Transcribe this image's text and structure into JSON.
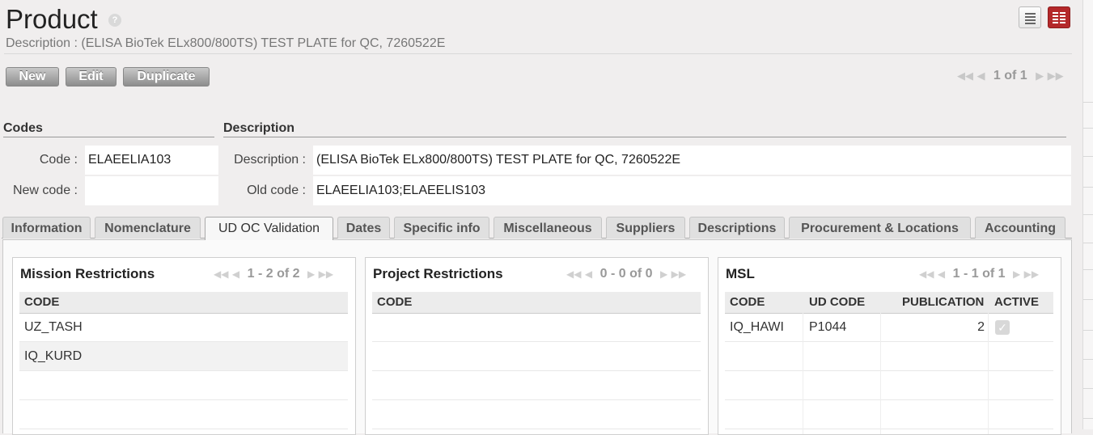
{
  "header": {
    "title": "Product",
    "help": "?",
    "subtitle": "Description : (ELISA BioTek ELx800/800TS) TEST PLATE for QC, 7260522E"
  },
  "toolbar": {
    "new_label": "New",
    "edit_label": "Edit",
    "duplicate_label": "Duplicate"
  },
  "pager": {
    "text": "1 of 1"
  },
  "codes": {
    "title": "Codes",
    "code_label": "Code :",
    "code_value": "ELAEELIA103",
    "new_code_label": "New code :",
    "new_code_value": ""
  },
  "description": {
    "title": "Description",
    "description_label": "Description :",
    "description_value": "(ELISA BioTek ELx800/800TS) TEST PLATE for QC, 7260522E",
    "old_code_label": "Old code :",
    "old_code_value": "ELAEELIA103;ELAEELIS103"
  },
  "tabs": [
    {
      "label": "Information"
    },
    {
      "label": "Nomenclature"
    },
    {
      "label": "UD OC Validation"
    },
    {
      "label": "Dates"
    },
    {
      "label": "Specific info"
    },
    {
      "label": "Miscellaneous"
    },
    {
      "label": "Suppliers"
    },
    {
      "label": "Descriptions"
    },
    {
      "label": "Procurement & Locations"
    },
    {
      "label": "Accounting"
    }
  ],
  "active_tab": "UD OC Validation",
  "mission": {
    "title": "Mission Restrictions",
    "pager": "1 - 2 of 2",
    "columns": [
      "CODE"
    ],
    "rows": [
      [
        "UZ_TASH"
      ],
      [
        "IQ_KURD"
      ]
    ]
  },
  "project": {
    "title": "Project Restrictions",
    "pager": "0 - 0 of 0",
    "columns": [
      "CODE"
    ],
    "rows": []
  },
  "msl": {
    "title": "MSL",
    "pager": "1 - 1 of 1",
    "columns": [
      "CODE",
      "UD CODE",
      "PUBLICATION",
      "ACTIVE"
    ],
    "rows": [
      {
        "code": "IQ_HAWI",
        "ud_code": "P1044",
        "publication": "2",
        "active": true
      }
    ]
  },
  "icons": {
    "help": "question-mark-icon",
    "list_view": "list-view-icon",
    "form_view": "form-view-icon",
    "first": "first-page-icon",
    "prev": "previous-page-icon",
    "next": "next-page-icon",
    "last": "last-page-icon",
    "check": "checkbox-checked-icon"
  },
  "colors": {
    "accent": "#b4282a",
    "button": "#a4a4a4",
    "background": "#f0eeee"
  }
}
